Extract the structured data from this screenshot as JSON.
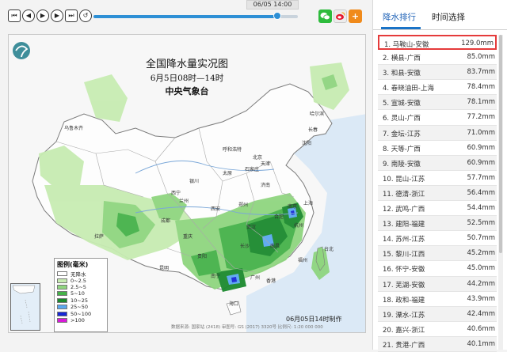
{
  "toolbar": {
    "buttons": [
      {
        "name": "first-frame-button",
        "icon": "skip-first-icon",
        "glyph": "⏮"
      },
      {
        "name": "prev-frame-button",
        "icon": "prev-icon",
        "glyph": "◀"
      },
      {
        "name": "play-button",
        "icon": "play-icon",
        "glyph": "▶"
      },
      {
        "name": "next-frame-button",
        "icon": "next-icon",
        "glyph": "▶"
      },
      {
        "name": "last-frame-button",
        "icon": "skip-last-icon",
        "glyph": "⏭"
      },
      {
        "name": "loop-button",
        "icon": "repeat-icon",
        "glyph": "↺"
      }
    ],
    "timeline_tooltip": "06/05 14:00",
    "timeline_progress": 0.9,
    "share_icons": [
      "wechat-icon",
      "weibo-icon",
      "add-icon"
    ],
    "colors": {
      "wechat": "#2dbb3c",
      "weibo": "#e8e8e8",
      "add": "#f08a1a"
    }
  },
  "map": {
    "title": "全国降水量实况图",
    "subtitle": "6月5日08时—14时",
    "org": "中央气象台",
    "legend": {
      "title": "图例(毫米)",
      "items": [
        {
          "label": "无降水",
          "color": "#ffffff"
        },
        {
          "label": "0~2.5",
          "color": "#c7ecb2"
        },
        {
          "label": "2.5~5",
          "color": "#8fd57f"
        },
        {
          "label": "5~10",
          "color": "#45b249"
        },
        {
          "label": "10~25",
          "color": "#1b8a2e"
        },
        {
          "label": "25~50",
          "color": "#5aa8f0"
        },
        {
          "label": "50~100",
          "color": "#1728d6"
        },
        {
          "label": ">100",
          "color": "#d81ad8"
        }
      ]
    },
    "footer_credit": "数据来源: 国家站 (2418)  审图号: GS (2017) 3320号  比例尺: 1:20 000 000",
    "footer_time": "06月05日14时制作",
    "city_labels": [
      "乌鲁木齐",
      "哈尔滨",
      "长春",
      "呼和浩特",
      "沈阳",
      "北京",
      "天津",
      "石家庄",
      "太原",
      "银川",
      "西宁",
      "兰州",
      "济南",
      "郑州",
      "西安",
      "合肥",
      "南京",
      "武汉",
      "成都",
      "重庆",
      "长沙",
      "南昌",
      "贵阳",
      "昆明",
      "福州",
      "台北",
      "南宁",
      "广州",
      "香港",
      "海口",
      "拉萨",
      "上海",
      "杭州"
    ]
  },
  "right_panel": {
    "tabs": [
      {
        "label": "降水排行",
        "active": true
      },
      {
        "label": "时间选择",
        "active": false
      }
    ],
    "rankings": [
      {
        "name": "1. 马鞍山-安徽",
        "value": "129.0mm"
      },
      {
        "name": "2. 横县-广西",
        "value": "85.0mm"
      },
      {
        "name": "3. 和县-安徽",
        "value": "83.7mm"
      },
      {
        "name": "4. 春晓油田-上海",
        "value": "78.4mm"
      },
      {
        "name": "5. 宣城-安徽",
        "value": "78.1mm"
      },
      {
        "name": "6. 灵山-广西",
        "value": "77.2mm"
      },
      {
        "name": "7. 金坛-江苏",
        "value": "71.0mm"
      },
      {
        "name": "8. 天等-广西",
        "value": "60.9mm"
      },
      {
        "name": "9. 南陵-安徽",
        "value": "60.9mm"
      },
      {
        "name": "10. 昆山-江苏",
        "value": "57.7mm"
      },
      {
        "name": "11. 德清-浙江",
        "value": "56.4mm"
      },
      {
        "name": "12. 武鸣-广西",
        "value": "54.4mm"
      },
      {
        "name": "13. 建阳-福建",
        "value": "52.5mm"
      },
      {
        "name": "14. 苏州-江苏",
        "value": "50.7mm"
      },
      {
        "name": "15. 黎川-江西",
        "value": "45.2mm"
      },
      {
        "name": "16. 怀宁-安徽",
        "value": "45.0mm"
      },
      {
        "name": "17. 芜湖-安徽",
        "value": "44.2mm"
      },
      {
        "name": "18. 政和-福建",
        "value": "43.9mm"
      },
      {
        "name": "19. 溧水-江苏",
        "value": "42.4mm"
      },
      {
        "name": "20. 嘉兴-浙江",
        "value": "40.6mm"
      },
      {
        "name": "21. 贵港-广西",
        "value": "40.1mm"
      }
    ]
  }
}
